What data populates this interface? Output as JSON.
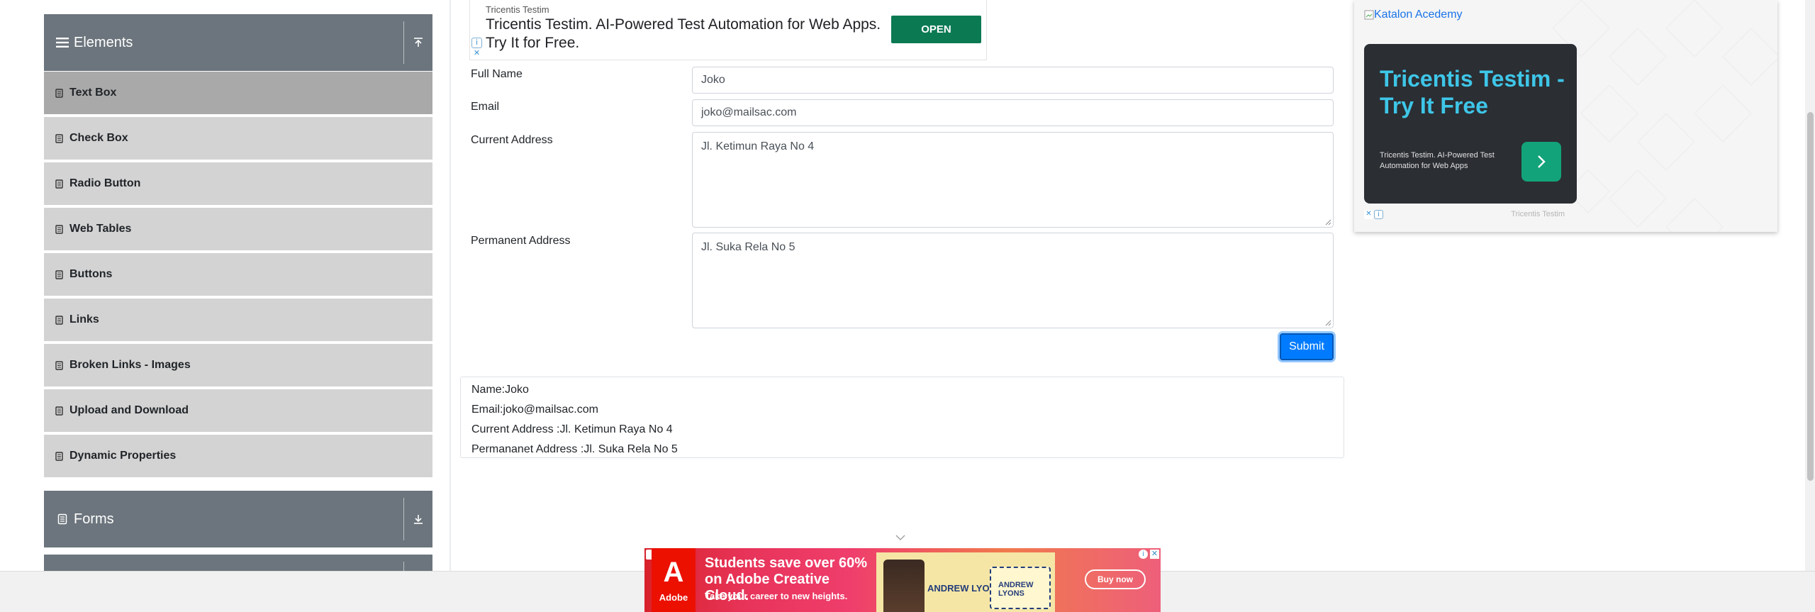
{
  "sidebar": {
    "elements_header": "Elements",
    "forms_header": "Forms",
    "items": [
      {
        "label": "Text Box",
        "active": true
      },
      {
        "label": "Check Box"
      },
      {
        "label": "Radio Button"
      },
      {
        "label": "Web Tables"
      },
      {
        "label": "Buttons"
      },
      {
        "label": "Links"
      },
      {
        "label": "Broken Links - Images"
      },
      {
        "label": "Upload and Download"
      },
      {
        "label": "Dynamic Properties"
      }
    ]
  },
  "top_ad": {
    "brand": "Tricentis Testim",
    "text": "Tricentis Testim. AI-Powered Test Automation for Web Apps. Try It for Free.",
    "button": "OPEN"
  },
  "form": {
    "full_name_label": "Full Name",
    "full_name_value": "Joko",
    "email_label": "Email",
    "email_value": "joko@mailsac.com",
    "current_address_label": "Current Address",
    "current_address_value": "Jl. Ketimun Raya No 4",
    "permanent_address_label": "Permanent Address",
    "permanent_address_value": "Jl. Suka Rela No 5",
    "submit_label": "Submit"
  },
  "output": {
    "name": "Name:Joko",
    "email": "Email:joko@mailsac.com",
    "current_address": "Current Address :Jl. Ketimun Raya No 4",
    "permanent_address": "Permananet Address :Jl. Suka Rela No 5"
  },
  "right_ad": {
    "broken_image_alt": "Katalon Acedemy",
    "card_title": "Tricentis Testim - Try It Free",
    "card_desc": "Tricentis Testim. AI-Powered Test Automation for Web Apps",
    "footer": "Tricentis Testim"
  },
  "bottom_ad": {
    "logo_text": "Adobe",
    "headline": "Students save over 60% on Adobe Creative Cloud.",
    "subline": "Take your career to new heights.",
    "promo_name": "ANDREW LYONS",
    "promo_card": "ANDREW LYONS",
    "buy_label": "Buy now"
  },
  "colors": {
    "sidebar_header": "#6c757d",
    "menu_item": "#d3d3d3",
    "menu_item_active": "#a9a9a9",
    "submit": "#007bff",
    "ad_open": "#0b7a53"
  }
}
